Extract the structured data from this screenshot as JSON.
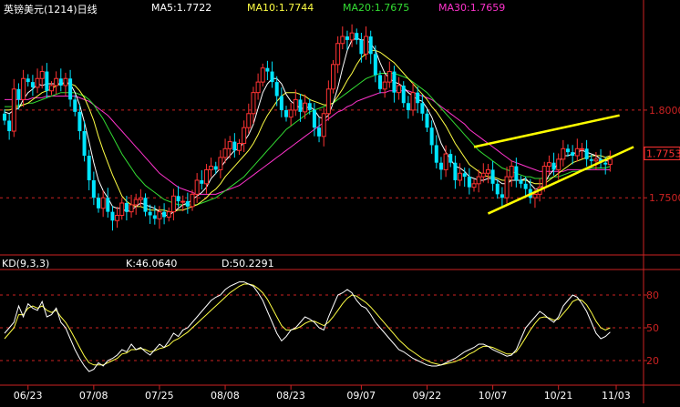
{
  "header": {
    "title": "英镑美元(1214)日线",
    "ma5": "MA5:1.7722",
    "ma10": "MA10:1.7744",
    "ma20": "MA20:1.7675",
    "ma30": "MA30:1.7659"
  },
  "kd_header": {
    "label": "KD(9,3,3)",
    "k": "K:46.0640",
    "d": "D:50.2291"
  },
  "colors": {
    "background": "#000000",
    "up": "#ff3333",
    "down": "#00e5ff",
    "ma5": "#ffffff",
    "ma10": "#ffff44",
    "ma20": "#33dd33",
    "ma30": "#ff33cc",
    "axis": "#cc2222",
    "trendline": "#ffff00",
    "current_price_box": "#ff3333"
  },
  "chart_data": [
    {
      "type": "candlestick",
      "series_label": "英镑美元(1214)日线",
      "y_ticks": [
        1.75,
        1.8
      ],
      "y_tick_labels": [
        "1.7500",
        "1.8000"
      ],
      "current_price_label": "1.7753",
      "current_price": 1.7753,
      "x_ticks": [
        "06/23",
        "07/08",
        "07/25",
        "08/08",
        "08/23",
        "09/07",
        "09/22",
        "10/07",
        "10/21",
        "11/03"
      ],
      "ylim": [
        1.72,
        1.855
      ],
      "close": [
        1.794,
        1.788,
        1.812,
        1.806,
        1.818,
        1.816,
        1.813,
        1.818,
        1.822,
        1.811,
        1.814,
        1.818,
        1.814,
        1.818,
        1.806,
        1.799,
        1.788,
        1.774,
        1.76,
        1.75,
        1.744,
        1.75,
        1.742,
        1.737,
        1.74,
        1.747,
        1.742,
        1.746,
        1.749,
        1.75,
        1.742,
        1.74,
        1.738,
        1.742,
        1.739,
        1.742,
        1.751,
        1.748,
        1.748,
        1.745,
        1.752,
        1.76,
        1.758,
        1.766,
        1.768,
        1.766,
        1.773,
        1.778,
        1.782,
        1.777,
        1.781,
        1.79,
        1.798,
        1.81,
        1.816,
        1.824,
        1.822,
        1.816,
        1.808,
        1.8,
        1.796,
        1.8,
        1.806,
        1.799,
        1.804,
        1.8,
        1.79,
        1.785,
        1.798,
        1.812,
        1.826,
        1.838,
        1.842,
        1.84,
        1.844,
        1.84,
        1.832,
        1.842,
        1.832,
        1.82,
        1.812,
        1.816,
        1.822,
        1.81,
        1.814,
        1.804,
        1.8,
        1.81,
        1.804,
        1.798,
        1.79,
        1.78,
        1.77,
        1.766,
        1.775,
        1.77,
        1.76,
        1.764,
        1.762,
        1.756,
        1.758,
        1.762,
        1.764,
        1.766,
        1.758,
        1.752,
        1.75,
        1.762,
        1.768,
        1.76,
        1.758,
        1.755,
        1.75,
        1.752,
        1.756,
        1.768,
        1.77,
        1.766,
        1.772,
        1.778,
        1.776,
        1.774,
        1.778,
        1.778,
        1.772,
        1.771,
        1.772,
        1.77,
        1.769,
        1.772
      ],
      "ma5": [
        1.799,
        1.798,
        1.8,
        1.801,
        1.806,
        1.81,
        1.812,
        1.815,
        1.814,
        1.815,
        1.815,
        1.815,
        1.815,
        1.816,
        1.815,
        1.81,
        1.803,
        1.793,
        1.782,
        1.77,
        1.76,
        1.754,
        1.75,
        1.745,
        1.744,
        1.744,
        1.742,
        1.743,
        1.745,
        1.747,
        1.746,
        1.745,
        1.744,
        1.742,
        1.74,
        1.74,
        1.742,
        1.744,
        1.746,
        1.747,
        1.749,
        1.751,
        1.753,
        1.756,
        1.761,
        1.764,
        1.767,
        1.771,
        1.774,
        1.777,
        1.778,
        1.782,
        1.786,
        1.792,
        1.801,
        1.81,
        1.815,
        1.818,
        1.818,
        1.815,
        1.809,
        1.805,
        1.803,
        1.801,
        1.801,
        1.802,
        1.8,
        1.796,
        1.795,
        1.797,
        1.804,
        1.813,
        1.824,
        1.834,
        1.84,
        1.841,
        1.84,
        1.84,
        1.838,
        1.834,
        1.827,
        1.821,
        1.818,
        1.816,
        1.815,
        1.813,
        1.81,
        1.808,
        1.806,
        1.805,
        1.801,
        1.796,
        1.789,
        1.781,
        1.776,
        1.772,
        1.768,
        1.767,
        1.765,
        1.762,
        1.761,
        1.76,
        1.76,
        1.761,
        1.761,
        1.76,
        1.758,
        1.758,
        1.76,
        1.76,
        1.76,
        1.761,
        1.758,
        1.755,
        1.755,
        1.758,
        1.763,
        1.766,
        1.77,
        1.774,
        1.774,
        1.775,
        1.776,
        1.777,
        1.776,
        1.775,
        1.774,
        1.772,
        1.771,
        1.771
      ],
      "ma10": [
        1.8,
        1.8,
        1.801,
        1.802,
        1.803,
        1.804,
        1.806,
        1.808,
        1.81,
        1.811,
        1.812,
        1.814,
        1.815,
        1.815,
        1.815,
        1.814,
        1.811,
        1.807,
        1.801,
        1.794,
        1.785,
        1.777,
        1.77,
        1.763,
        1.757,
        1.751,
        1.748,
        1.746,
        1.745,
        1.745,
        1.744,
        1.743,
        1.743,
        1.743,
        1.743,
        1.742,
        1.742,
        1.743,
        1.743,
        1.744,
        1.745,
        1.746,
        1.748,
        1.75,
        1.753,
        1.755,
        1.758,
        1.762,
        1.765,
        1.768,
        1.771,
        1.774,
        1.777,
        1.781,
        1.786,
        1.792,
        1.797,
        1.801,
        1.805,
        1.808,
        1.81,
        1.81,
        1.81,
        1.809,
        1.808,
        1.806,
        1.805,
        1.804,
        1.803,
        1.803,
        1.804,
        1.808,
        1.812,
        1.817,
        1.821,
        1.826,
        1.83,
        1.832,
        1.834,
        1.834,
        1.833,
        1.831,
        1.829,
        1.827,
        1.824,
        1.821,
        1.818,
        1.815,
        1.812,
        1.809,
        1.806,
        1.802,
        1.799,
        1.795,
        1.791,
        1.786,
        1.781,
        1.777,
        1.773,
        1.769,
        1.767,
        1.765,
        1.763,
        1.762,
        1.762,
        1.761,
        1.76,
        1.76,
        1.76,
        1.76,
        1.76,
        1.76,
        1.759,
        1.758,
        1.758,
        1.758,
        1.76,
        1.762,
        1.764,
        1.766,
        1.768,
        1.77,
        1.771,
        1.772,
        1.773,
        1.774,
        1.774,
        1.774,
        1.773,
        1.774
      ],
      "ma20": [
        1.802,
        1.802,
        1.802,
        1.803,
        1.803,
        1.804,
        1.804,
        1.805,
        1.806,
        1.807,
        1.808,
        1.809,
        1.81,
        1.81,
        1.81,
        1.81,
        1.809,
        1.808,
        1.806,
        1.803,
        1.799,
        1.795,
        1.79,
        1.785,
        1.78,
        1.775,
        1.771,
        1.767,
        1.763,
        1.76,
        1.757,
        1.755,
        1.753,
        1.751,
        1.749,
        1.748,
        1.747,
        1.746,
        1.746,
        1.746,
        1.746,
        1.746,
        1.747,
        1.748,
        1.749,
        1.75,
        1.752,
        1.754,
        1.756,
        1.758,
        1.76,
        1.762,
        1.765,
        1.768,
        1.771,
        1.774,
        1.777,
        1.78,
        1.783,
        1.786,
        1.789,
        1.791,
        1.793,
        1.795,
        1.797,
        1.799,
        1.8,
        1.801,
        1.802,
        1.803,
        1.804,
        1.806,
        1.808,
        1.81,
        1.812,
        1.814,
        1.816,
        1.818,
        1.819,
        1.82,
        1.821,
        1.821,
        1.821,
        1.821,
        1.82,
        1.819,
        1.818,
        1.816,
        1.814,
        1.812,
        1.81,
        1.807,
        1.804,
        1.801,
        1.798,
        1.795,
        1.792,
        1.789,
        1.786,
        1.783,
        1.78,
        1.777,
        1.775,
        1.773,
        1.771,
        1.769,
        1.767,
        1.766,
        1.765,
        1.764,
        1.763,
        1.762,
        1.762,
        1.761,
        1.761,
        1.761,
        1.761,
        1.762,
        1.762,
        1.763,
        1.764,
        1.765,
        1.765,
        1.766,
        1.766,
        1.767,
        1.767,
        1.767,
        1.767,
        1.768
      ],
      "ma30": [
        1.806,
        1.806,
        1.806,
        1.806,
        1.806,
        1.806,
        1.807,
        1.807,
        1.807,
        1.808,
        1.808,
        1.808,
        1.808,
        1.808,
        1.808,
        1.808,
        1.807,
        1.806,
        1.805,
        1.803,
        1.801,
        1.799,
        1.797,
        1.794,
        1.791,
        1.788,
        1.785,
        1.782,
        1.779,
        1.776,
        1.773,
        1.77,
        1.767,
        1.764,
        1.762,
        1.76,
        1.758,
        1.756,
        1.755,
        1.754,
        1.753,
        1.752,
        1.752,
        1.752,
        1.752,
        1.752,
        1.753,
        1.754,
        1.755,
        1.756,
        1.757,
        1.759,
        1.761,
        1.763,
        1.765,
        1.767,
        1.769,
        1.771,
        1.773,
        1.775,
        1.777,
        1.779,
        1.781,
        1.783,
        1.785,
        1.787,
        1.789,
        1.791,
        1.793,
        1.795,
        1.797,
        1.799,
        1.8,
        1.802,
        1.803,
        1.805,
        1.806,
        1.807,
        1.808,
        1.809,
        1.81,
        1.81,
        1.811,
        1.811,
        1.811,
        1.811,
        1.811,
        1.81,
        1.809,
        1.808,
        1.807,
        1.806,
        1.804,
        1.802,
        1.8,
        1.798,
        1.796,
        1.794,
        1.792,
        1.789,
        1.787,
        1.785,
        1.783,
        1.781,
        1.779,
        1.777,
        1.775,
        1.773,
        1.771,
        1.77,
        1.769,
        1.768,
        1.767,
        1.766,
        1.765,
        1.765,
        1.765,
        1.765,
        1.765,
        1.765,
        1.766,
        1.766,
        1.766,
        1.766,
        1.766,
        1.766,
        1.766,
        1.766,
        1.766,
        1.766
      ]
    },
    {
      "type": "line",
      "series_label": "KD(9,3,3)",
      "y_ticks": [
        20,
        50,
        80
      ],
      "ylim": [
        0,
        100
      ],
      "k": [
        45,
        50,
        55,
        70,
        60,
        72,
        68,
        66,
        74,
        60,
        62,
        68,
        55,
        50,
        40,
        30,
        22,
        15,
        10,
        12,
        18,
        15,
        20,
        22,
        25,
        30,
        28,
        35,
        30,
        32,
        28,
        25,
        30,
        35,
        32,
        38,
        45,
        42,
        48,
        50,
        55,
        60,
        65,
        70,
        75,
        78,
        80,
        85,
        88,
        90,
        92,
        92,
        90,
        88,
        82,
        75,
        65,
        55,
        45,
        38,
        42,
        48,
        50,
        55,
        60,
        58,
        55,
        50,
        48,
        60,
        70,
        80,
        82,
        85,
        82,
        75,
        70,
        68,
        62,
        55,
        50,
        45,
        40,
        35,
        30,
        28,
        25,
        22,
        20,
        18,
        16,
        15,
        15,
        16,
        18,
        20,
        22,
        25,
        28,
        30,
        32,
        35,
        35,
        33,
        30,
        28,
        26,
        24,
        25,
        30,
        40,
        50,
        55,
        60,
        65,
        62,
        58,
        55,
        60,
        70,
        75,
        80,
        78,
        72,
        65,
        55,
        45,
        40,
        42,
        46
      ],
      "d": [
        40,
        45,
        50,
        62,
        62,
        68,
        70,
        68,
        70,
        66,
        64,
        66,
        60,
        55,
        48,
        40,
        32,
        24,
        18,
        16,
        16,
        16,
        18,
        20,
        22,
        26,
        27,
        30,
        30,
        31,
        30,
        28,
        29,
        31,
        32,
        34,
        38,
        40,
        43,
        46,
        50,
        54,
        58,
        62,
        66,
        70,
        74,
        78,
        82,
        85,
        88,
        90,
        90,
        89,
        86,
        82,
        76,
        68,
        60,
        52,
        48,
        48,
        49,
        51,
        54,
        56,
        56,
        54,
        52,
        55,
        60,
        66,
        72,
        77,
        80,
        79,
        76,
        73,
        69,
        64,
        59,
        54,
        49,
        44,
        39,
        35,
        31,
        28,
        25,
        22,
        20,
        18,
        17,
        16,
        17,
        18,
        19,
        21,
        23,
        26,
        28,
        31,
        33,
        33,
        32,
        30,
        28,
        26,
        26,
        28,
        34,
        41,
        48,
        54,
        59,
        60,
        59,
        57,
        58,
        63,
        68,
        74,
        76,
        75,
        71,
        64,
        56,
        50,
        48,
        50
      ]
    }
  ],
  "trendlines": {
    "upper": {
      "from": [
        100,
        1.779
      ],
      "to": [
        131,
        1.797
      ]
    },
    "lower": {
      "from": [
        103,
        1.741
      ],
      "to": [
        134,
        1.779
      ]
    }
  }
}
